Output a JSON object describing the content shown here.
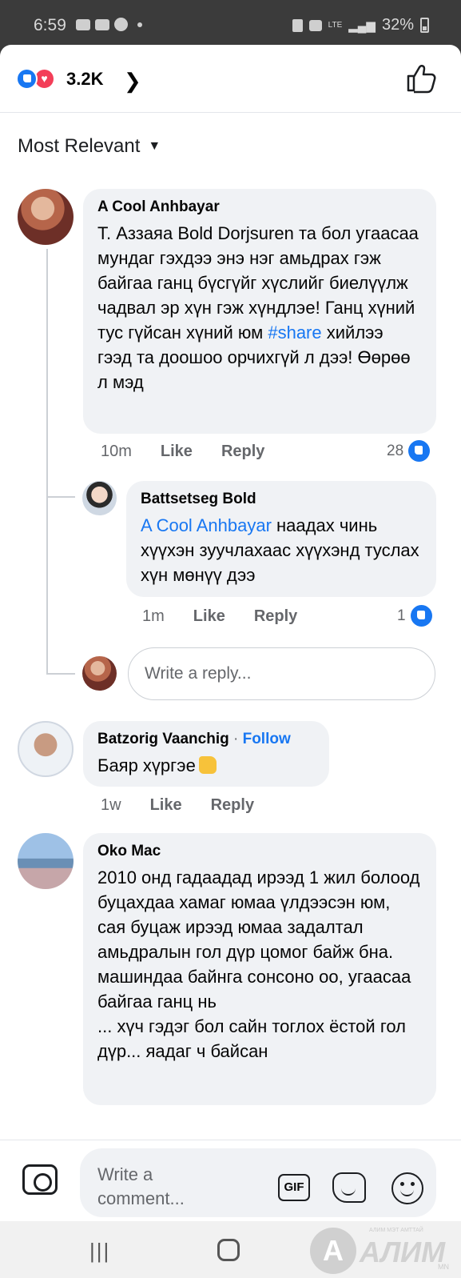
{
  "status_bar": {
    "time": "6:59",
    "network": "LTE",
    "battery": "32%",
    "icons": [
      "video-icon",
      "gmail-icon",
      "messenger-icon",
      "notification-dot-icon",
      "lock-icon",
      "mute-icon",
      "signal-icon",
      "battery-icon"
    ]
  },
  "reactions": {
    "count": "3.2K",
    "types": [
      "like",
      "love"
    ]
  },
  "sort": {
    "label": "Most Relevant"
  },
  "comments": [
    {
      "author": "A Cool Anhbayar",
      "text_before": "Т. Аззаяа Bold Dorjsuren  та бол угаасаа мундаг гэхдээ энэ нэг амьдрах гэж байгаа ганц бүсгүйг хүслийг биелүүлж чадвал эр хүн гэж хүндлэе! Ганц хүний тус гүйсан хүний юм ",
      "hashtag": "#share",
      "text_after": " хийлээ гээд та доошоо орчихгүй л дээ! Өөрөө л мэд",
      "time": "10m",
      "like_label": "Like",
      "reply_label": "Reply",
      "reaction_count": "28",
      "replies": [
        {
          "author": "Battsetseg Bold",
          "mention": "A Cool Anhbayar",
          "text": " наадах чинь хүүхэн зуучлахаас хүүхэнд туслах хүн мөнүү дээ",
          "time": "1m",
          "like_label": "Like",
          "reply_label": "Reply",
          "reaction_count": "1"
        }
      ],
      "reply_input_placeholder": "Write a reply..."
    },
    {
      "author": "Batzorig Vaanchig",
      "separator": "·",
      "follow_label": "Follow",
      "text": "Баяр хүргэе",
      "time": "1w",
      "like_label": "Like",
      "reply_label": "Reply"
    },
    {
      "author": "Oko Mac",
      "text": "2010 онд гадаадад ирээд 1 жил болоод буцахдаа хамаг юмаа үлдээсэн юм, сая буцаж ирээд юмаа задалтал амьдралын гол дүр цомог байж бна. машиндаа байнга сонсоно оо, угаасаа байгаа ганц нь\n... хүч гэдэг бол сайн тоглох ёстой гол дүр... яадаг ч байсан"
    }
  ],
  "composer": {
    "placeholder": "Write a comment...",
    "gif_label": "GIF"
  },
  "watermark": {
    "letter": "А",
    "text": "АЛИМ",
    "small_text": "АЛИМ МЭТ АМТТАЙ",
    "suffix": "MN"
  }
}
